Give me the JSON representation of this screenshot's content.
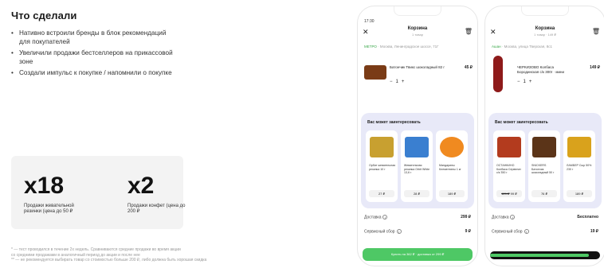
{
  "heading": "Что сделали",
  "bullets": [
    "Нативно встроили бренды в блок рекомендаций для покупателей",
    "Увеличили продажи бестселлеров на прикассовой зоне",
    "Создали импульс к покупке / напомнили о покупке"
  ],
  "stats": [
    {
      "value": "x18",
      "caption": "Продажи жевательной резинки (цена до 50 ₽"
    },
    {
      "value": "x2",
      "caption": "Продажи конфет (цена до 200 ₽"
    }
  ],
  "footnote": [
    "* — тест проводился в течение 2х недель. Сравниваются средние продажи во время акции",
    "со средними продажами в аналогичный период до акции и после нее",
    "** — не рекомендуется выбирать товар со стоимостью больше 200 ₽, либо должна быть хорошая скидка"
  ],
  "phone1": {
    "time": "17:30",
    "title": "Корзина",
    "subtitle": "1 товар",
    "store": "МЕТРО",
    "address": "Москва, Ленинградское шоссе, 71Г",
    "item": {
      "name": "Батончик Твикс шоколадный 82 г",
      "price": "45 ₽",
      "qty": "1"
    },
    "reco_title": "Вас может заинтересовать",
    "cards": [
      {
        "name": "Орбит жевательная резинка 10 г",
        "price": "27 ₽",
        "color": "#c8a030"
      },
      {
        "name": "Жевательная резинка Orbit White 13,6 г",
        "price": "28 ₽",
        "color": "#3a7fd0"
      },
      {
        "name": "Мандарины Клементины 1 кг",
        "price": "189 ₽",
        "color": "#f08a20"
      }
    ],
    "sum_label": "Доставка",
    "sum_value": "299 ₽",
    "fee_label": "Сервисный сбор",
    "fee_value": "9 ₽",
    "cta": "Купить на 362 ₽ · доставка от 299 ₽"
  },
  "phone2": {
    "title": "Корзина",
    "subtitle": "1 товар · 149 ₽",
    "store": "Ашан",
    "address": "Москва, улица Тверская, 8с1",
    "item": {
      "name": "ЧЕРКИЗОВО Колбаса Бородинская с/к 300г · мини",
      "price": "149 ₽",
      "qty": "1"
    },
    "reco_title": "Вас может заинтересовать",
    "cards": [
      {
        "name": "ОСТАНКИНО Колбаса Сервелат с/к 350 г",
        "price": "99 ₽",
        "old": "129 ₽",
        "color": "#b33b1e"
      },
      {
        "name": "SNICKERS Батончик шоколадный 50 г",
        "price": "76 ₽",
        "color": "#5b3418"
      },
      {
        "name": "ЛАМБЕР Сыр 50% 230 г",
        "price": "189 ₽",
        "color": "#d9a21c"
      }
    ],
    "sum_label": "Доставка",
    "sum_value": "Бесплатно",
    "fee_label": "Сервисный сбор",
    "fee_value": "19 ₽",
    "progress": 0.9
  }
}
